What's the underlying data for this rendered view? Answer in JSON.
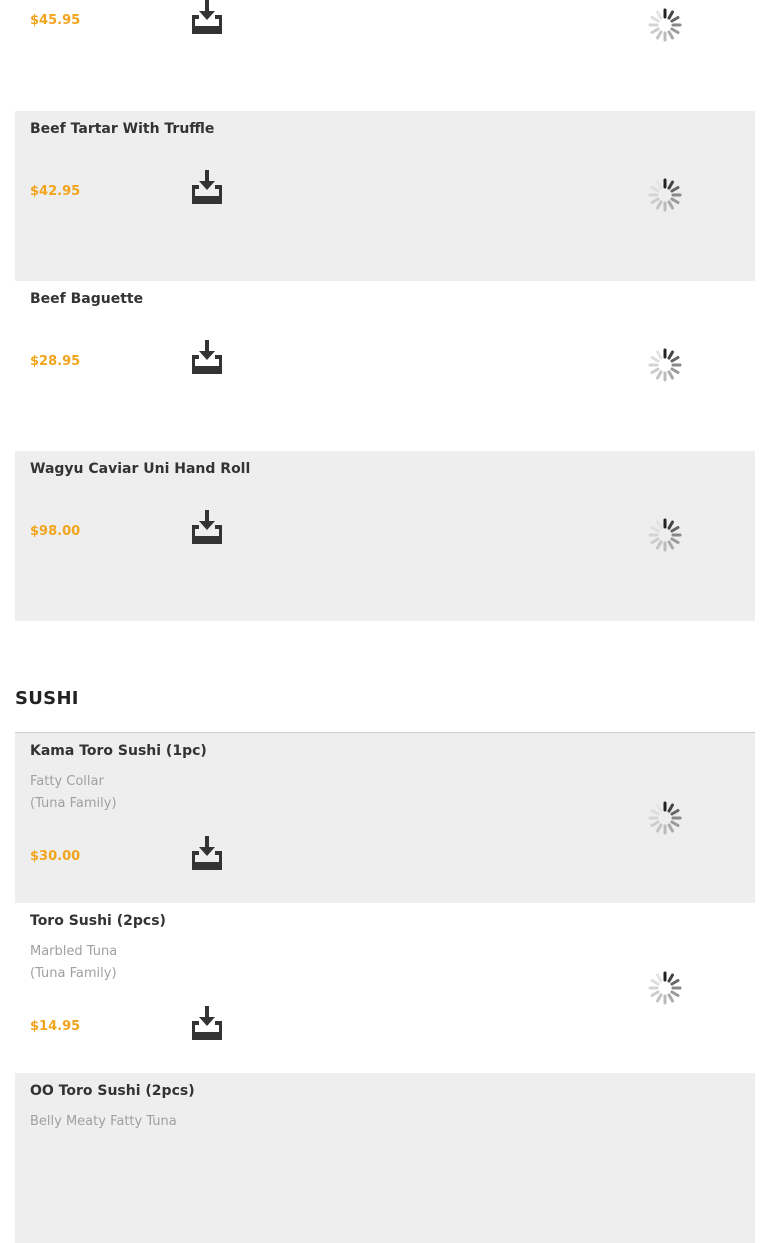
{
  "colors": {
    "price": "#f2a41c",
    "shaded_row": "#eeeeee",
    "title": "#333333",
    "description": "#a0a0a0"
  },
  "icons": {
    "add": "add-to-cart-tray-icon",
    "loading": "loading-spinner-icon"
  },
  "items_top": [
    {
      "title": "",
      "price": "$45.95"
    },
    {
      "title": "Beef Tartar With Truffle",
      "price": "$42.95"
    },
    {
      "title": "Beef Baguette",
      "price": "$28.95"
    },
    {
      "title": "Wagyu Caviar Uni Hand Roll",
      "price": "$98.00"
    }
  ],
  "section": {
    "title": "SUSHI"
  },
  "sushi_items": [
    {
      "title": "Kama Toro Sushi (1pc)",
      "desc_line1": "Fatty Collar",
      "desc_line2": "(Tuna Family)",
      "price": "$30.00"
    },
    {
      "title": "Toro Sushi (2pcs)",
      "desc_line1": "Marbled Tuna",
      "desc_line2": "(Tuna Family)",
      "price": "$14.95"
    },
    {
      "title": "OO Toro Sushi (2pcs)",
      "desc_line1": "Belly Meaty Fatty Tuna",
      "desc_line2": "",
      "price": ""
    }
  ]
}
